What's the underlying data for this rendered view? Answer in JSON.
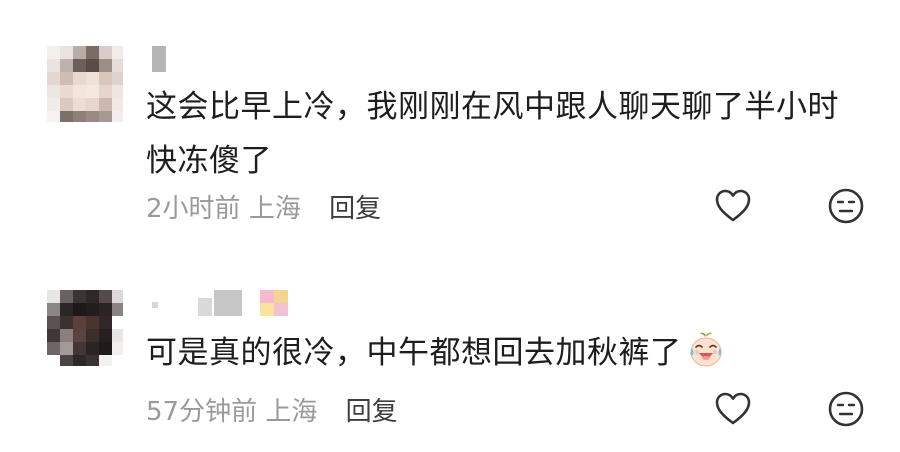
{
  "comments": [
    {
      "text_lines": [
        "这会比早上冷，我刚刚在风中跟人聊天聊了半小时",
        "快冻傻了"
      ],
      "time": "2小时前",
      "location": "上海",
      "reply_label": "回复"
    },
    {
      "text": "可是真的很冷，中午都想回去加秋裤了",
      "emoji": "laughing-crying-emoji",
      "time": "57分钟前",
      "location": "上海",
      "reply_label": "回复"
    }
  ],
  "icons": {
    "like": "heart-outline-icon",
    "dislike": "meh-face-icon"
  },
  "colors": {
    "text": "#1e1e1e",
    "meta": "#9a9a9a",
    "reply": "#3e3e3e",
    "icon": "#333333"
  }
}
